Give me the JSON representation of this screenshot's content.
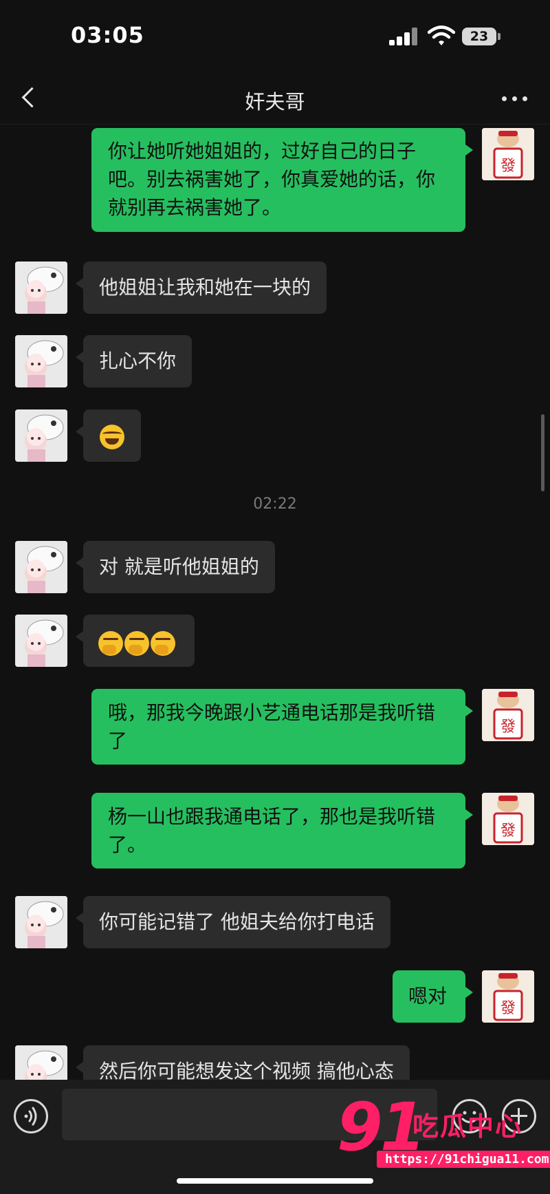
{
  "status_bar": {
    "time": "03:05",
    "battery": "23"
  },
  "header": {
    "title": "奸夫哥"
  },
  "messages": [
    {
      "from": "self",
      "text": "你让她听她姐姐的，过好自己的日子吧。别去祸害她了，你真爱她的话，你就别再去祸害她了。"
    },
    {
      "from": "other",
      "text": "他姐姐让我和她在一块的"
    },
    {
      "from": "other",
      "text": "扎心不你"
    },
    {
      "from": "other",
      "emoji": "laughing-tears-emoji"
    },
    {
      "timestamp": "02:22"
    },
    {
      "from": "other",
      "text": "对 就是听他姐姐的"
    },
    {
      "from": "other",
      "emoji": "hand-over-mouth-emoji x3"
    },
    {
      "from": "self",
      "text": "哦，那我今晚跟小艺通电话那是我听错了"
    },
    {
      "from": "self",
      "text": "杨一山也跟我通电话了，那也是我听错了。"
    },
    {
      "from": "other",
      "text": "你可能记错了 他姐夫给你打电话"
    },
    {
      "from": "self",
      "text": "嗯对"
    },
    {
      "from": "other",
      "text": "然后你可能想发这个视频 搞他心态"
    }
  ],
  "input": {
    "value": ""
  },
  "watermark": {
    "number": "91",
    "text": "吃瓜中心",
    "url": "https://91chigua11.com"
  }
}
